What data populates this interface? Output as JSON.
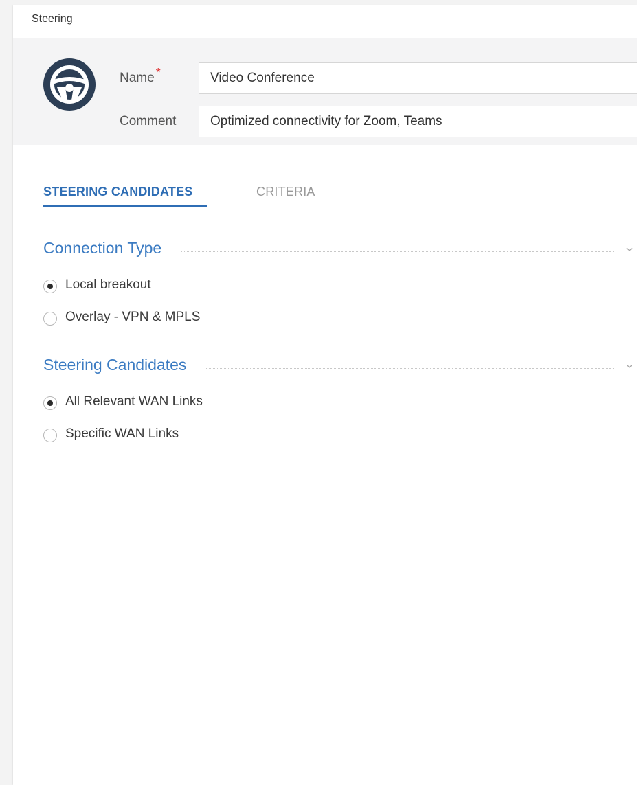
{
  "window": {
    "title": "Steering"
  },
  "form": {
    "name_label": "Name",
    "required_mark": "*",
    "name_value": "Video Conference",
    "comment_label": "Comment",
    "comment_value": "Optimized connectivity for Zoom, Teams"
  },
  "tabs": [
    {
      "label": "STEERING CANDIDATES",
      "active": true
    },
    {
      "label": "CRITERIA",
      "active": false
    }
  ],
  "sections": {
    "connection_type": {
      "title": "Connection Type",
      "options": [
        {
          "label": "Local breakout",
          "checked": true
        },
        {
          "label": "Overlay - VPN & MPLS",
          "checked": false
        }
      ]
    },
    "steering_candidates": {
      "title": "Steering Candidates",
      "options": [
        {
          "label": "All Relevant WAN Links",
          "checked": true
        },
        {
          "label": "Specific WAN Links",
          "checked": false
        }
      ]
    }
  },
  "icons": {
    "avatar": "steering-wheel-icon",
    "collapse": "chevron-down-icon"
  },
  "colors": {
    "accent": "#2f6eb5",
    "section_title": "#3b7bc2",
    "avatar": "#2c3e55",
    "required": "#e03c3c"
  }
}
